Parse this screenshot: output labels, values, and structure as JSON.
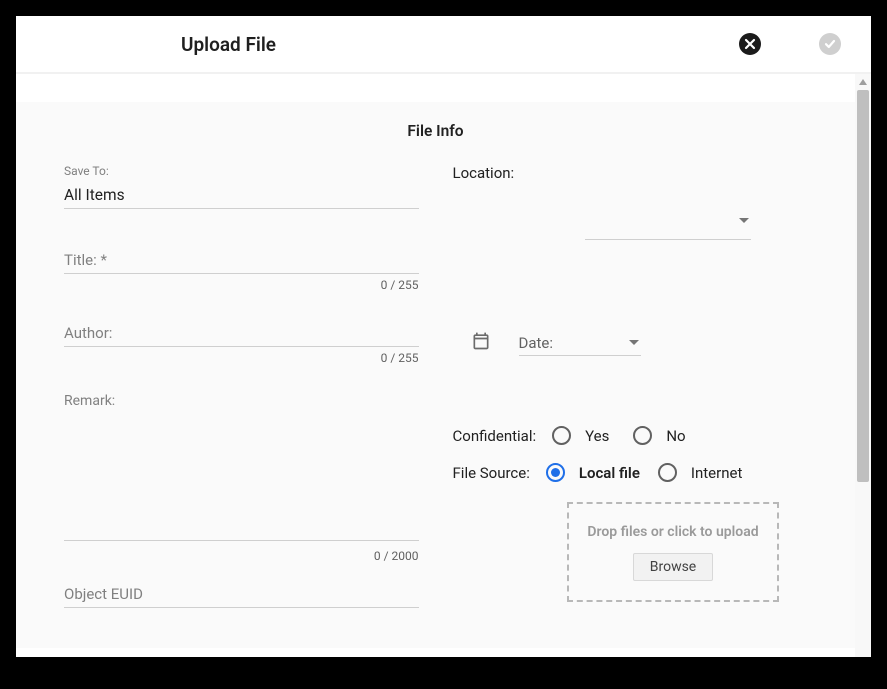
{
  "header": {
    "title": "Upload File"
  },
  "panel": {
    "title": "File Info"
  },
  "left": {
    "save_to_label": "Save To:",
    "save_to_value": "All Items",
    "title_label": "Title: *",
    "title_value": "",
    "title_counter": "0 / 255",
    "author_label": "Author:",
    "author_value": "",
    "author_counter": "0 / 255",
    "remark_label": "Remark:",
    "remark_value": "",
    "remark_counter": "0 / 2000",
    "object_euid_label": "Object EUID",
    "object_euid_value": ""
  },
  "right": {
    "location_label": "Location:",
    "location_value": "",
    "date_label": "Date:",
    "confidential_label": "Confidential:",
    "confidential_yes": "Yes",
    "confidential_no": "No",
    "confidential_selected": null,
    "file_source_label": "File Source:",
    "file_source_local": "Local file",
    "file_source_internet": "Internet",
    "file_source_selected": "local",
    "dropzone_text": "Drop files or click to upload",
    "browse_label": "Browse"
  }
}
